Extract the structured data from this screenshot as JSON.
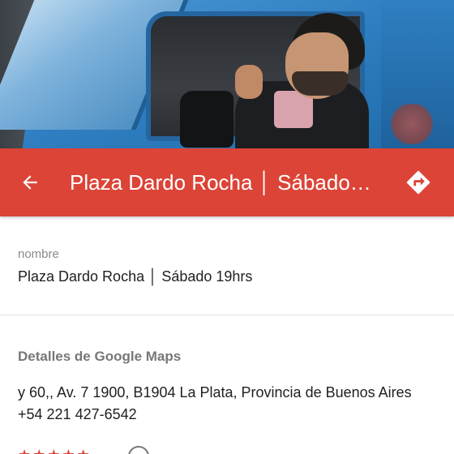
{
  "app_bar": {
    "title": "Plaza Dardo Rocha │ Sábado 19hrs",
    "background_color": "#db4437",
    "back_icon": "arrow-left-icon",
    "directions_icon": "directions-icon"
  },
  "hero": {
    "image": "photo of man in blue truck cab"
  },
  "name_section": {
    "label": "nombre",
    "value": "Plaza Dardo Rocha │ Sábado 19hrs"
  },
  "maps_section": {
    "heading": "Detalles de Google Maps",
    "address": "y 60,, Av. 7 1900, B1904 La Plata, Provincia de Buenos Aires",
    "phone": "+54 221 427-6542",
    "rating_icon": "star-icon",
    "info_icon": "info-icon"
  }
}
